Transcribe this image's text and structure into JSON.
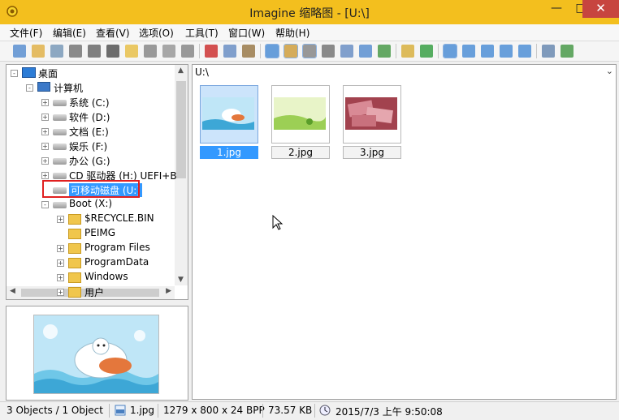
{
  "window": {
    "title": "Imagine 缩略图 - [U:\\]"
  },
  "menu": [
    "文件(F)",
    "编辑(E)",
    "查看(V)",
    "选项(O)",
    "工具(T)",
    "窗口(W)",
    "帮助(H)"
  ],
  "toolbar": {
    "icons": [
      "eye-icon",
      "folder-open-icon",
      "copy-pages-icon",
      "print-icon",
      "info-icon",
      "camera-icon",
      "new-folder-icon",
      "rename-icon",
      "trash-icon",
      "settings-icon",
      "cut-icon",
      "copy-icon",
      "paste-icon",
      "view-list-icon",
      "sort-icon",
      "history-icon",
      "filter-icon",
      "grid-icon",
      "gallery-icon",
      "image-icon",
      "up-folder-icon",
      "refresh-icon",
      "large-icons-icon",
      "small-icons-icon",
      "details-icon",
      "list-icon",
      "thumbnails-icon",
      "wrench-icon",
      "add-icon"
    ]
  },
  "tree": {
    "nodes": [
      {
        "label": "桌面",
        "icon": "desktop-icon",
        "level": 0,
        "expander": "-"
      },
      {
        "label": "计算机",
        "icon": "computer-icon",
        "level": 1,
        "expander": "-"
      },
      {
        "label": "系统 (C:)",
        "icon": "drive-icon",
        "level": 2,
        "expander": "+"
      },
      {
        "label": "软件 (D:)",
        "icon": "drive-icon",
        "level": 2,
        "expander": "+"
      },
      {
        "label": "文档 (E:)",
        "icon": "drive-icon",
        "level": 2,
        "expander": "+"
      },
      {
        "label": "娱乐 (F:)",
        "icon": "drive-icon",
        "level": 2,
        "expander": "+"
      },
      {
        "label": "办公 (G:)",
        "icon": "drive-icon",
        "level": 2,
        "expander": "+"
      },
      {
        "label": "CD 驱动器 (H:) UEFI+B",
        "icon": "cd-drive-icon",
        "level": 2,
        "expander": "+"
      },
      {
        "label": "可移动磁盘 (U:)",
        "icon": "removable-drive-icon",
        "level": 2,
        "expander": "",
        "selected": true
      },
      {
        "label": "Boot (X:)",
        "icon": "drive-icon",
        "level": 2,
        "expander": "-"
      },
      {
        "label": "$RECYCLE.BIN",
        "icon": "folder-icon",
        "level": 3,
        "expander": "+"
      },
      {
        "label": "PEIMG",
        "icon": "folder-icon",
        "level": 3,
        "expander": ""
      },
      {
        "label": "Program Files",
        "icon": "folder-icon",
        "level": 3,
        "expander": "+"
      },
      {
        "label": "ProgramData",
        "icon": "folder-icon",
        "level": 3,
        "expander": "+"
      },
      {
        "label": "Windows",
        "icon": "folder-icon",
        "level": 3,
        "expander": "+"
      },
      {
        "label": "用户",
        "icon": "folder-icon",
        "level": 3,
        "expander": "+"
      }
    ]
  },
  "address": {
    "path": "U:\\"
  },
  "files": [
    {
      "name": "1.jpg",
      "selected": true,
      "thumb": "cartoon-fish"
    },
    {
      "name": "2.jpg",
      "selected": false,
      "thumb": "green-nature"
    },
    {
      "name": "3.jpg",
      "selected": false,
      "thumb": "banknotes"
    }
  ],
  "status": {
    "objects": "3 Objects / 1 Object",
    "file": "1.jpg",
    "dimensions": "1279 x 800 x 24 BPP",
    "size": "73.57 KB",
    "datetime": "2015/7/3 上午 9:50:08"
  },
  "colors": {
    "titlebar": "#f3bf1e",
    "close": "#c7453f",
    "selection": "#3399ff",
    "highlight_box": "#e02020"
  }
}
